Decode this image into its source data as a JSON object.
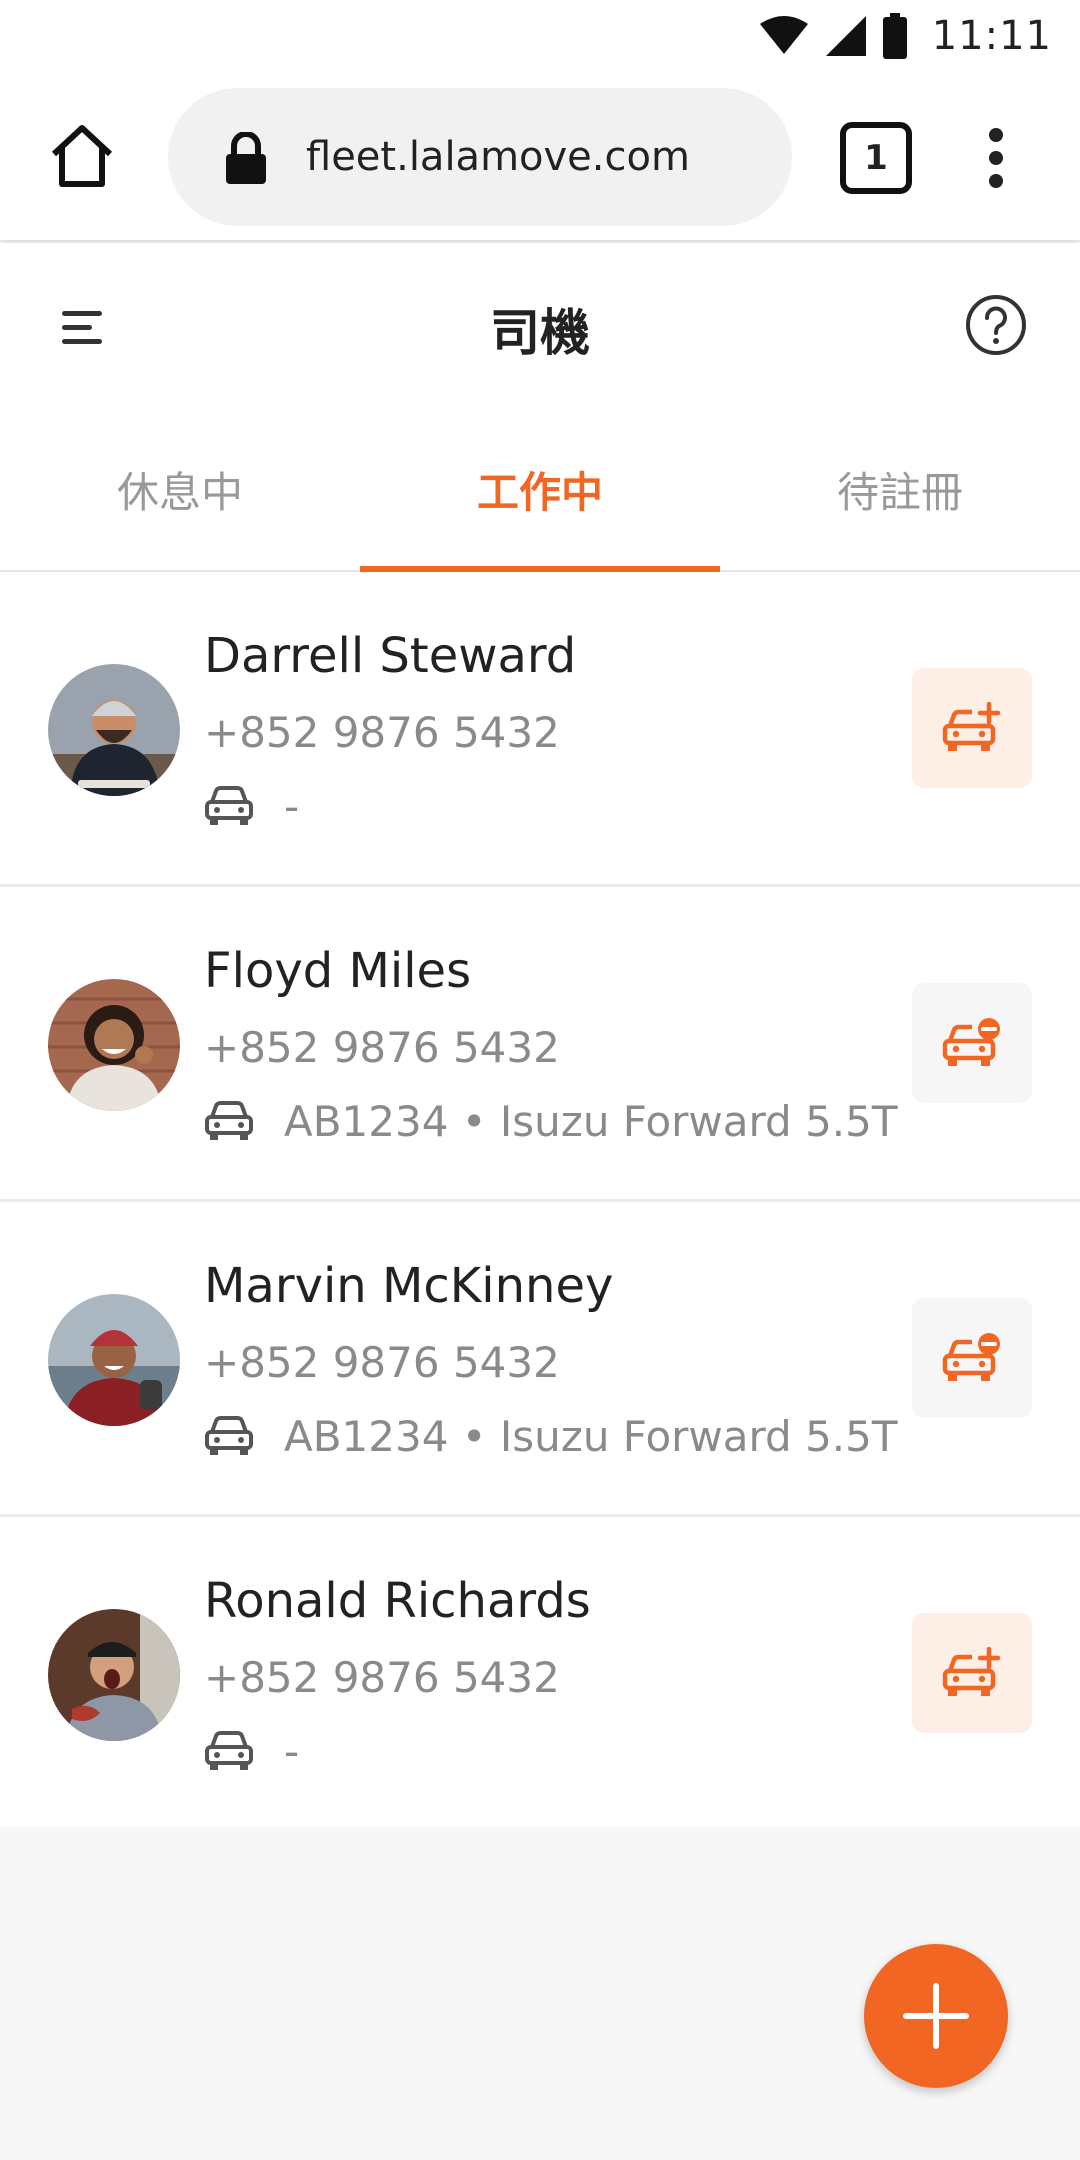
{
  "status_bar": {
    "time": "11:11"
  },
  "browser": {
    "url": "fleet.lalamove.com",
    "tab_count": "1"
  },
  "header": {
    "title": "司機"
  },
  "tabs": [
    {
      "label": "休息中",
      "active": false
    },
    {
      "label": "工作中",
      "active": true
    },
    {
      "label": "待註冊",
      "active": false
    }
  ],
  "drivers": [
    {
      "name": "Darrell Steward",
      "phone": "+852 9876 5432",
      "vehicle": "-",
      "action": "assign-vehicle"
    },
    {
      "name": "Floyd Miles",
      "phone": "+852 9876 5432",
      "vehicle": "AB1234 • Isuzu Forward 5.5T",
      "action": "remove-vehicle"
    },
    {
      "name": "Marvin McKinney",
      "phone": "+852 9876 5432",
      "vehicle": "AB1234 • Isuzu Forward 5.5T",
      "action": "remove-vehicle"
    },
    {
      "name": "Ronald Richards",
      "phone": "+852 9876 5432",
      "vehicle": "-",
      "action": "assign-vehicle"
    }
  ],
  "colors": {
    "accent": "#f16622",
    "accent_soft": "#fdeee6",
    "muted_text": "#8a8a8a"
  },
  "icons": [
    "wifi-icon",
    "signal-icon",
    "battery-icon",
    "home-icon",
    "lock-icon",
    "menu-icon",
    "help-icon",
    "car-icon",
    "car-add-icon",
    "car-remove-icon",
    "plus-icon"
  ]
}
